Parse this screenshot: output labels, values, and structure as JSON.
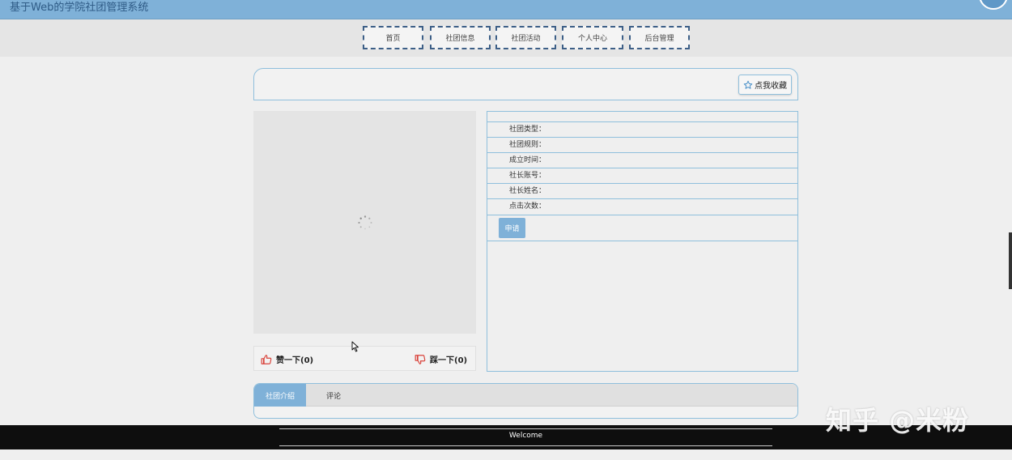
{
  "header": {
    "title": "基于Web的学院社团管理系统"
  },
  "nav": {
    "items": [
      {
        "label": "首页"
      },
      {
        "label": "社团信息"
      },
      {
        "label": "社团活动"
      },
      {
        "label": "个人中心"
      },
      {
        "label": "后台管理"
      }
    ]
  },
  "favorite": {
    "label": "点我收藏",
    "icon": "star-outline-icon"
  },
  "image": {
    "loading_icon": "spinner-icon"
  },
  "votes": {
    "like_label": "赞一下(0)",
    "like_icon": "thumbs-up-icon",
    "dislike_label": "踩一下(0)",
    "dislike_icon": "thumbs-down-icon"
  },
  "details": {
    "fields": [
      {
        "label": "社团类型："
      },
      {
        "label": "社团规则："
      },
      {
        "label": "成立时间："
      },
      {
        "label": "社长账号："
      },
      {
        "label": "社长姓名："
      },
      {
        "label": "点击次数："
      }
    ],
    "apply_label": "申请"
  },
  "tabs": {
    "items": [
      {
        "label": "社团介绍"
      },
      {
        "label": "评论"
      }
    ]
  },
  "footer": {
    "welcome": "Welcome"
  },
  "watermark": "知乎 @米粉",
  "colors": {
    "accent": "#7fb1d8",
    "border": "#8fbfdc",
    "nav_border": "#3d5f87",
    "footer_bg": "#0e0e0e",
    "like": "#d9433b"
  }
}
